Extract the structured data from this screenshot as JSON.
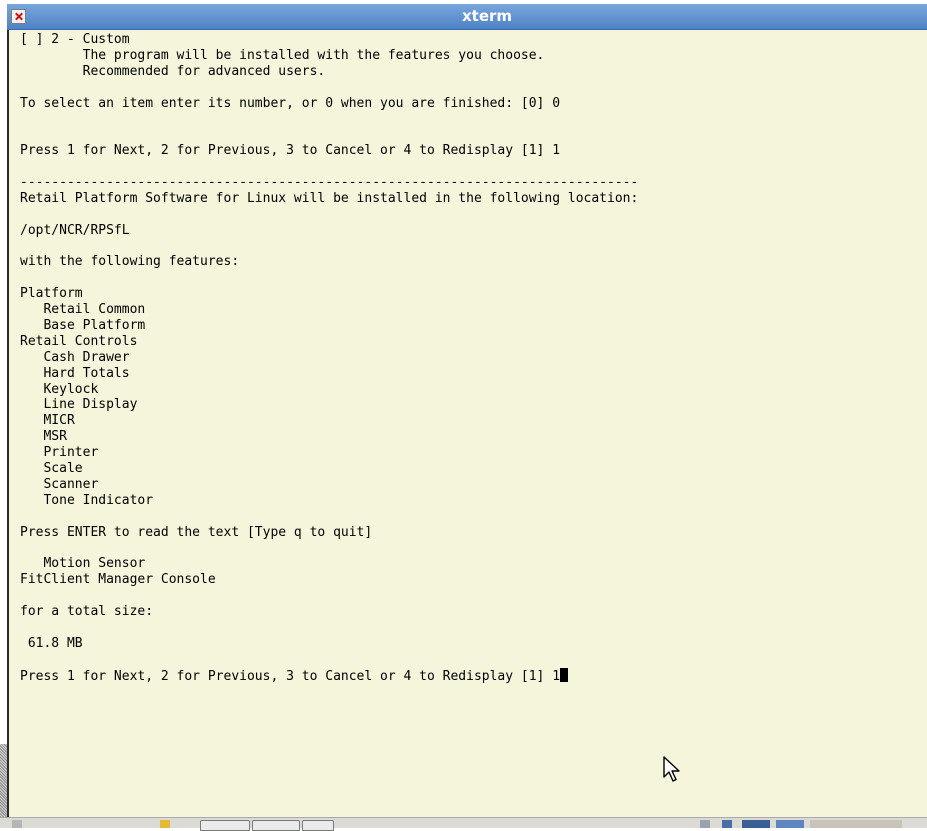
{
  "window": {
    "title": "xterm"
  },
  "terminal": {
    "lines": [
      "[ ] 2 - Custom",
      "        The program will be installed with the features you choose.",
      "        Recommended for advanced users.",
      "",
      "To select an item enter its number, or 0 when you are finished: [0] 0",
      "",
      "",
      "Press 1 for Next, 2 for Previous, 3 to Cancel or 4 to Redisplay [1] 1",
      "",
      "-------------------------------------------------------------------------------",
      "Retail Platform Software for Linux will be installed in the following location:",
      "",
      "/opt/NCR/RPSfL",
      "",
      "with the following features:",
      "",
      "Platform",
      "   Retail Common",
      "   Base Platform",
      "Retail Controls",
      "   Cash Drawer",
      "   Hard Totals",
      "   Keylock",
      "   Line Display",
      "   MICR",
      "   MSR",
      "   Printer",
      "   Scale",
      "   Scanner",
      "   Tone Indicator",
      "",
      "Press ENTER to read the text [Type q to quit]",
      "",
      "   Motion Sensor",
      "FitClient Manager Console",
      "",
      "for a total size:",
      "",
      " 61.8 MB",
      "",
      "Press 1 for Next, 2 for Previous, 3 to Cancel or 4 to Redisplay [1] 1"
    ]
  },
  "icons": {
    "close": "close-icon",
    "pointer": "mouse-pointer-icon",
    "cursor": "text-cursor-block"
  },
  "colors": {
    "terminal_background": "#f5f5dc",
    "terminal_text": "#000000",
    "titlebar": "#5b8fd0",
    "close_x": "#cc1010"
  }
}
